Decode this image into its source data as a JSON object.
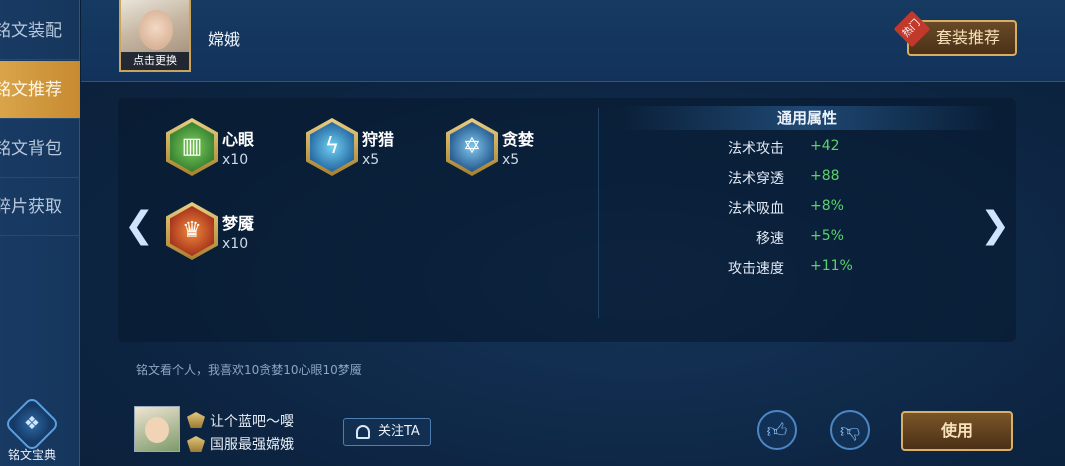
{
  "sidebar": {
    "items": [
      {
        "label": "铭文装配",
        "active": false
      },
      {
        "label": "铭文推荐",
        "active": true
      },
      {
        "label": "铭文背包",
        "active": false
      },
      {
        "label": "碎片获取",
        "active": false
      }
    ],
    "bottom_label": "铭文宝典"
  },
  "header": {
    "hero_name": "嫦娥",
    "portrait_caption": "点击更换",
    "set_button_label": "套装推荐",
    "hot_tag": "热门"
  },
  "runes": [
    {
      "name": "心眼",
      "count": "x10",
      "color": "#3d8a3a",
      "icon": "heart-eye-rune-icon"
    },
    {
      "name": "狩猎",
      "count": "x5",
      "color": "#2c7ab8",
      "icon": "hunt-rune-icon"
    },
    {
      "name": "贪婪",
      "count": "x5",
      "color": "#2f6fa8",
      "icon": "greed-rune-icon"
    },
    {
      "name": "梦魇",
      "count": "x10",
      "color": "#b83a24",
      "icon": "nightmare-rune-icon"
    }
  ],
  "attributes": {
    "title": "通用属性",
    "rows": [
      {
        "key": "法术攻击",
        "value": "+42"
      },
      {
        "key": "法术穿透",
        "value": "+88"
      },
      {
        "key": "法术吸血",
        "value": "+8%"
      },
      {
        "key": "移速",
        "value": "+5%"
      },
      {
        "key": "攻击速度",
        "value": "+11%"
      }
    ]
  },
  "comment": "铭文看个人，我喜欢10贪婪10心眼10梦魇",
  "author": {
    "name": "让个蓝吧～嘤",
    "title": "国服最强嫦娥"
  },
  "follow_label": "关注TA",
  "use_label": "使用",
  "colors": {
    "accent_gold": "#d7ae63",
    "positive_green": "#5ad36a",
    "sidebar_active": "#d9a44a"
  }
}
